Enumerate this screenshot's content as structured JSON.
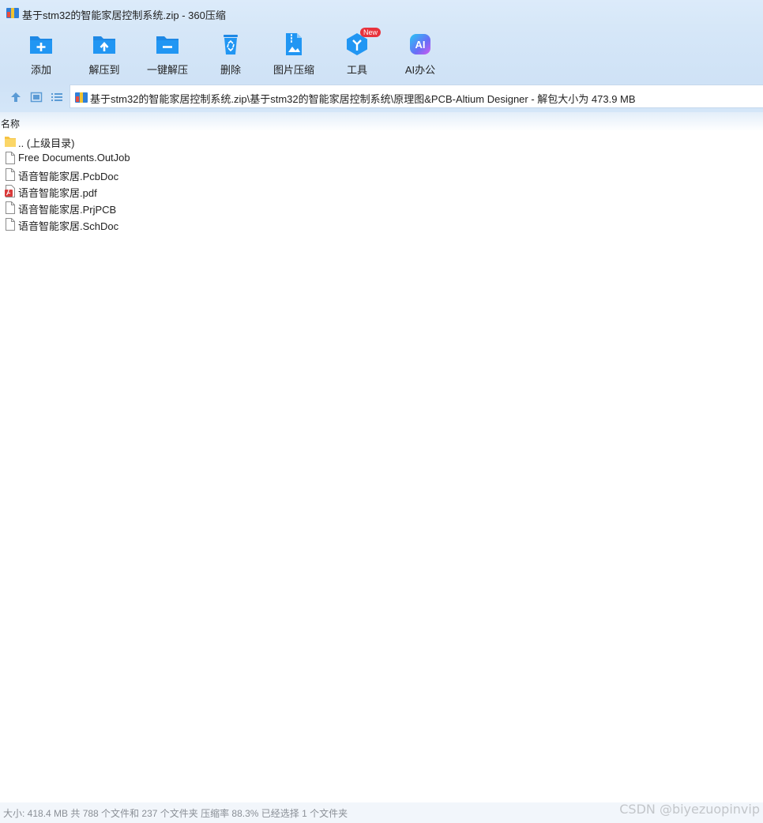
{
  "window": {
    "title": "基于stm32的智能家居控制系统.zip - 360压缩"
  },
  "toolbar": {
    "buttons": [
      {
        "label": "添加",
        "icon": "add-folder-icon"
      },
      {
        "label": "解压到",
        "icon": "extract-to-icon"
      },
      {
        "label": "一键解压",
        "icon": "one-click-extract-icon"
      },
      {
        "label": "删除",
        "icon": "recycle-delete-icon"
      },
      {
        "label": "图片压缩",
        "icon": "image-compress-icon"
      },
      {
        "label": "工具",
        "icon": "tools-hexagon-icon",
        "badge": "New"
      },
      {
        "label": "AI办公",
        "icon": "ai-office-icon"
      }
    ],
    "icon_color": "#1e88e5",
    "badge_color": "#e8323c"
  },
  "address": {
    "path": "基于stm32的智能家居控制系统.zip\\基于stm32的智能家居控制系统\\原理图&PCB-Altium Designer - 解包大小为 473.9 MB"
  },
  "list": {
    "column_name": "名称",
    "files": [
      {
        "name": ".. (上级目录)",
        "icon": "folder-icon"
      },
      {
        "name": "Free Documents.OutJob",
        "icon": "file-icon"
      },
      {
        "name": "语音智能家居.PcbDoc",
        "icon": "file-icon"
      },
      {
        "name": "语音智能家居.pdf",
        "icon": "pdf-icon"
      },
      {
        "name": "语音智能家居.PrjPCB",
        "icon": "file-icon"
      },
      {
        "name": "语音智能家居.SchDoc",
        "icon": "file-icon"
      }
    ]
  },
  "status": {
    "text": "大小: 418.4 MB 共 788 个文件和 237 个文件夹 压缩率 88.3% 已经选择 1 个文件夹"
  },
  "watermark": "CSDN @biyezuopinvip"
}
